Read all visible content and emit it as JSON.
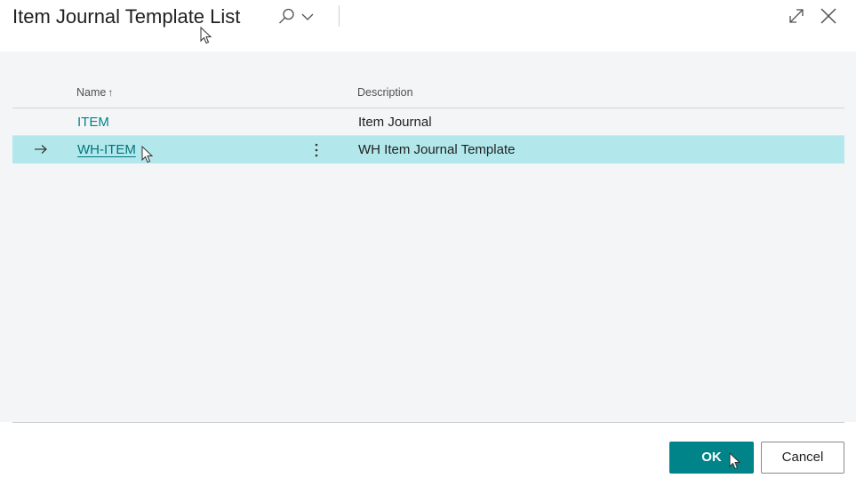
{
  "dialog": {
    "title": "Item Journal Template List"
  },
  "header_icons": [
    "search-icon",
    "chevron-down-icon",
    "expand-icon",
    "close-icon"
  ],
  "table": {
    "columns": [
      {
        "label": "Name",
        "sort": "ascending",
        "sort_glyph": "↑"
      },
      {
        "label": "Description"
      }
    ],
    "rows": [
      {
        "name": "ITEM",
        "description": "Item Journal",
        "selected": false
      },
      {
        "name": "WH-ITEM",
        "description": "WH Item Journal Template",
        "selected": true
      }
    ]
  },
  "footer": {
    "ok_label": "OK",
    "cancel_label": "Cancel"
  },
  "colors": {
    "accent": "#008489",
    "selected_row": "#b2e8ec",
    "content_bg": "#f4f5f7"
  }
}
